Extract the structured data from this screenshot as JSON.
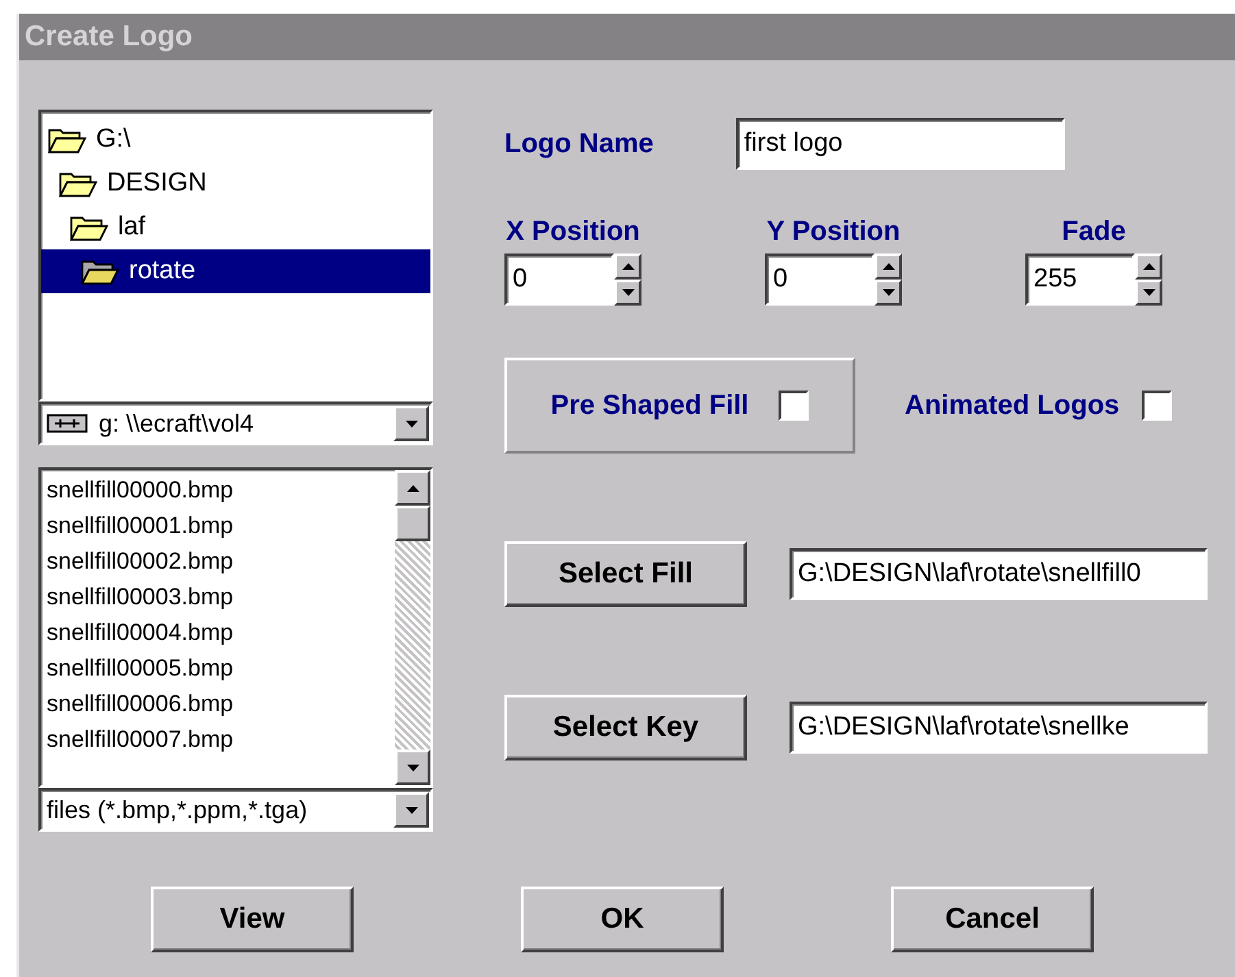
{
  "window": {
    "title": "Create Logo"
  },
  "folder_tree": [
    {
      "name": "G:\\",
      "selected": false,
      "children": [
        {
          "name": "DESIGN",
          "selected": false,
          "children": [
            {
              "name": "laf",
              "selected": false,
              "children": [
                {
                  "name": "rotate",
                  "selected": true
                }
              ]
            }
          ]
        }
      ]
    }
  ],
  "drive": {
    "value": "g: \\\\ecraft\\vol4"
  },
  "files": [
    "snellfill00000.bmp",
    "snellfill00001.bmp",
    "snellfill00002.bmp",
    "snellfill00003.bmp",
    "snellfill00004.bmp",
    "snellfill00005.bmp",
    "snellfill00006.bmp",
    "snellfill00007.bmp"
  ],
  "file_filter": {
    "value": "files (*.bmp,*.ppm,*.tga)"
  },
  "logo_name": {
    "label": "Logo Name",
    "value": "first logo"
  },
  "spinners": [
    {
      "label": "X Position",
      "value": "0"
    },
    {
      "label": "Y Position",
      "value": "0"
    },
    {
      "label": "Fade",
      "value": "255"
    }
  ],
  "pre_shaped_fill": {
    "label": "Pre Shaped Fill",
    "checked": false
  },
  "animated_logos": {
    "label": "Animated Logos",
    "checked": false
  },
  "select_fill": {
    "button": "Select Fill",
    "value": "G:\\DESIGN\\laf\\rotate\\snellfill0"
  },
  "select_key": {
    "button": "Select Key",
    "value": "G:\\DESIGN\\laf\\rotate\\snellke"
  },
  "buttons": [
    "View",
    "OK",
    "Cancel"
  ]
}
